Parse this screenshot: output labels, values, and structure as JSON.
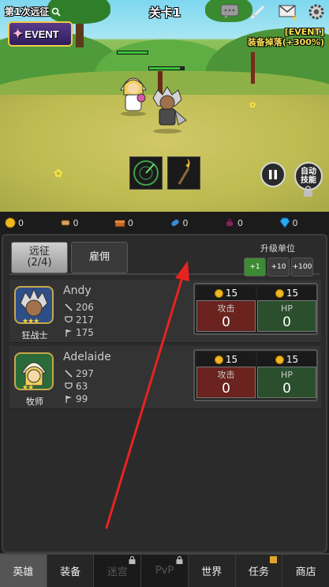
{
  "hud": {
    "expedition": "第1次远征",
    "event_button": "EVENT",
    "stage": "关卡1",
    "event_note_line1": "[EVENT]",
    "event_note_line2": "装备掉落(+300%)",
    "auto_skill_line1": "自动",
    "auto_skill_line2": "技能"
  },
  "resources": [
    {
      "icon": "gold-coin-icon",
      "value": "0"
    },
    {
      "icon": "scroll-icon",
      "value": "0"
    },
    {
      "icon": "treasure-chest-icon",
      "value": "0"
    },
    {
      "icon": "potion-capsule-icon",
      "value": "0"
    },
    {
      "icon": "beetle-icon",
      "value": "0"
    },
    {
      "icon": "diamond-icon",
      "value": "0"
    }
  ],
  "panel": {
    "tabs": [
      {
        "label": "远征\n(2/4)"
      },
      {
        "label": "雇佣"
      }
    ],
    "upgrade_label": "升级单位",
    "upgrade_buttons": [
      "+1",
      "+10",
      "+100"
    ],
    "attack_label": "攻击",
    "hp_label": "HP"
  },
  "heroes": [
    {
      "name": "Andy",
      "class": "狂战士",
      "attack": "206",
      "defense": "217",
      "speed": "175",
      "atk_cost": "15",
      "hp_cost": "15",
      "atk_level": "0",
      "hp_level": "0",
      "stars": "★★★"
    },
    {
      "name": "Adelaide",
      "class": "牧师",
      "attack": "297",
      "defense": "63",
      "speed": "99",
      "atk_cost": "15",
      "hp_cost": "15",
      "atk_level": "0",
      "hp_level": "0",
      "stars": "★★"
    }
  ],
  "nav": [
    {
      "label": "英雄"
    },
    {
      "label": "装备"
    },
    {
      "label": "迷宫"
    },
    {
      "label": "PvP"
    },
    {
      "label": "世界"
    },
    {
      "label": "任务"
    },
    {
      "label": "商店"
    }
  ],
  "colors": {
    "accent_green": "#3c8a34",
    "attack_red": "#6a231e",
    "hp_green": "#2b4f2c",
    "gold": "#f0b81f",
    "event_yellow": "#ffe15a",
    "arrow_red": "#e8231f"
  }
}
